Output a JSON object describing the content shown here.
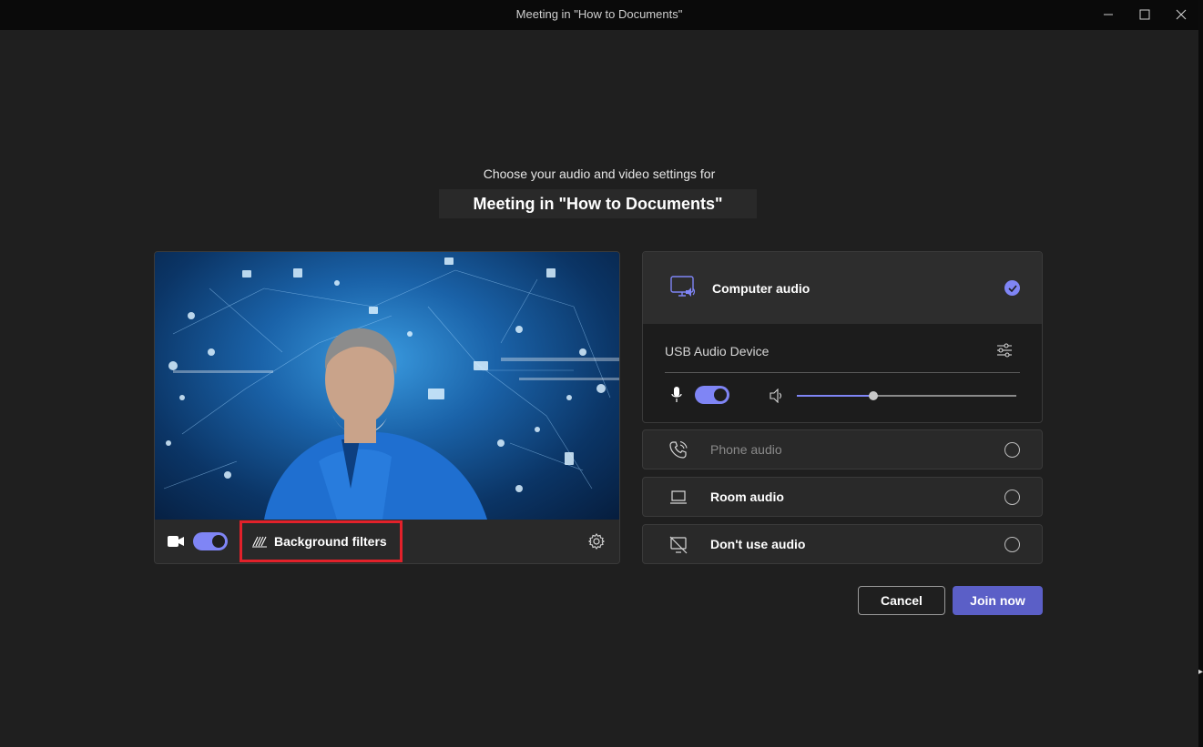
{
  "window": {
    "title": "Meeting in \"How to Documents\"",
    "controls": [
      "minimize-icon",
      "maximize-icon",
      "close-icon"
    ]
  },
  "prejoin": {
    "subtitle": "Choose your audio and video settings for",
    "meeting_title": "Meeting in \"How to Documents\""
  },
  "video": {
    "camera_on": true,
    "background_filters_label": "Background filters",
    "icons": [
      "video-camera-icon",
      "background-filters-icon",
      "gear-icon"
    ]
  },
  "audio": {
    "computer_audio_label": "Computer audio",
    "computer_audio_selected": true,
    "device_label": "USB Audio Device",
    "mic_on": true,
    "speaker_volume": 0.35,
    "options": [
      {
        "label": "Phone audio",
        "enabled": false,
        "selected": false,
        "icon": "phone-audio-icon"
      },
      {
        "label": "Room audio",
        "enabled": true,
        "selected": false,
        "icon": "room-audio-icon"
      },
      {
        "label": "Don't use audio",
        "enabled": true,
        "selected": false,
        "icon": "no-audio-icon"
      }
    ]
  },
  "actions": {
    "cancel_label": "Cancel",
    "join_label": "Join now"
  },
  "colors": {
    "accent": "#7f85f5",
    "join_button": "#5b5fc7",
    "highlight_box": "#e2212a",
    "background": "#1f1f1f"
  }
}
